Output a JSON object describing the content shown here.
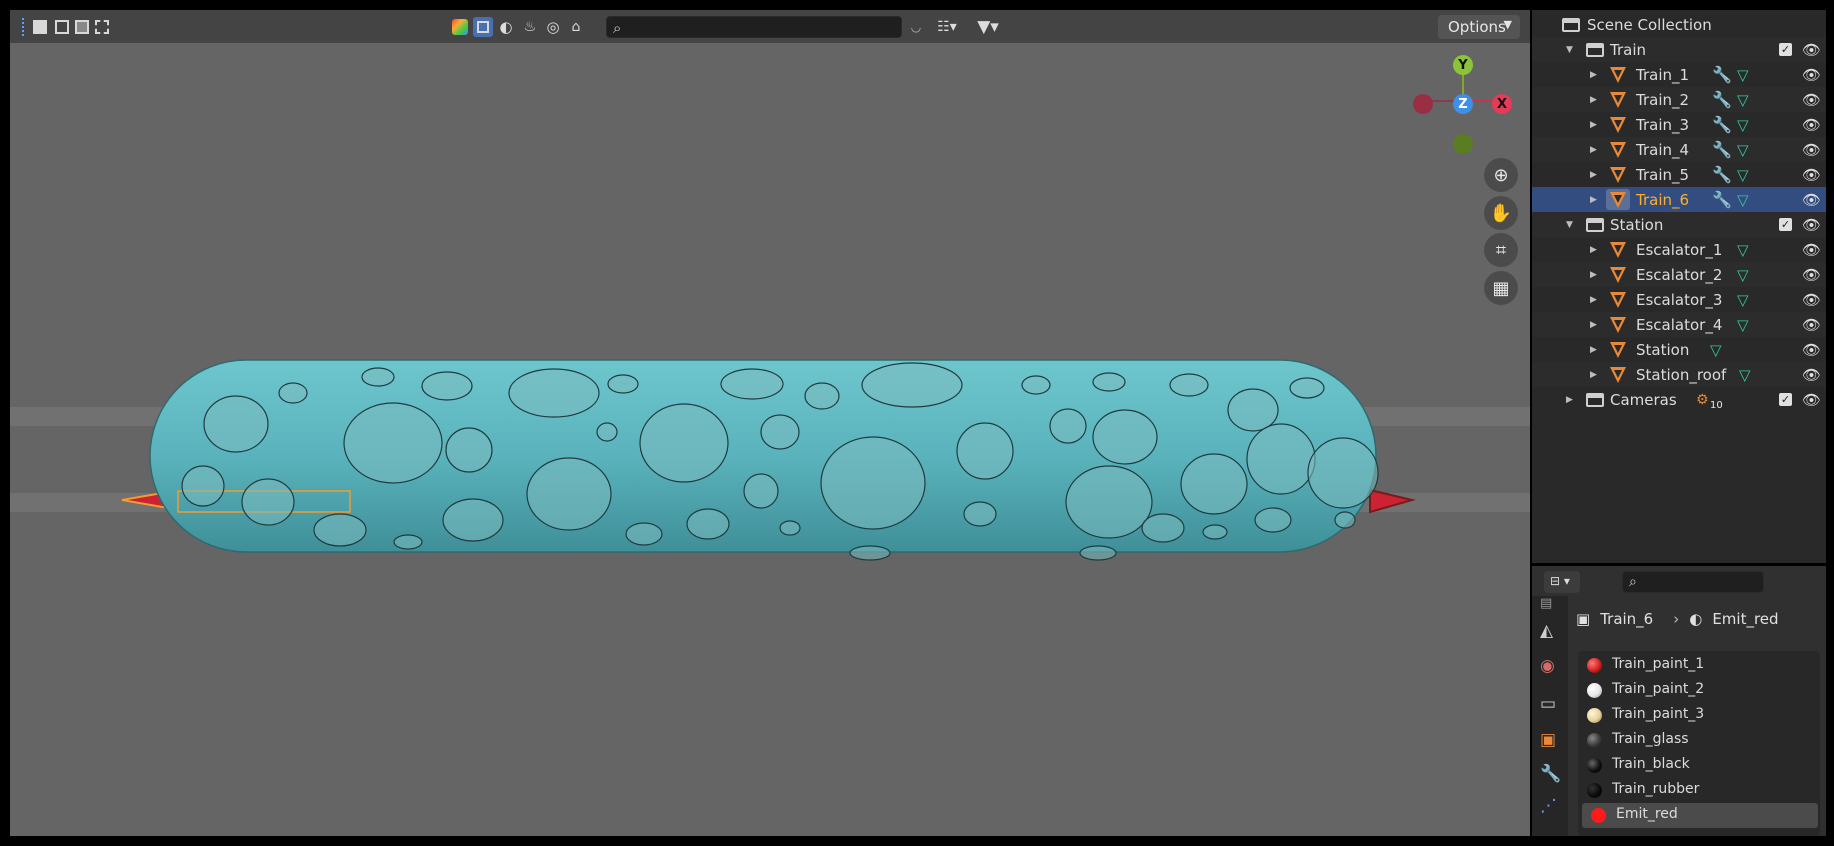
{
  "viewport": {
    "options_label": "Options",
    "search_placeholder": "",
    "gizmo": {
      "y_label": "Y",
      "z_label": "Z",
      "x_label": "X"
    }
  },
  "outliner": {
    "scene_collection": "Scene Collection",
    "rows": [
      {
        "label": "Train",
        "type": "collection"
      },
      {
        "label": "Train_1",
        "type": "mesh"
      },
      {
        "label": "Train_2",
        "type": "mesh"
      },
      {
        "label": "Train_3",
        "type": "mesh"
      },
      {
        "label": "Train_4",
        "type": "mesh"
      },
      {
        "label": "Train_5",
        "type": "mesh"
      },
      {
        "label": "Train_6",
        "type": "mesh",
        "selected": true
      },
      {
        "label": "Station",
        "type": "collection"
      },
      {
        "label": "Escalator_1",
        "type": "mesh"
      },
      {
        "label": "Escalator_2",
        "type": "mesh"
      },
      {
        "label": "Escalator_3",
        "type": "mesh"
      },
      {
        "label": "Escalator_4",
        "type": "mesh"
      },
      {
        "label": "Station",
        "type": "mesh"
      },
      {
        "label": "Station_roof",
        "type": "mesh"
      },
      {
        "label": "Cameras",
        "type": "collection"
      }
    ],
    "cameras_count": "10"
  },
  "properties": {
    "breadcrumb_object": "Train_6",
    "breadcrumb_material": "Emit_red",
    "materials": [
      {
        "label": "Train_paint_1",
        "color": "#d42020"
      },
      {
        "label": "Train_paint_2",
        "color": "#f0f0f0"
      },
      {
        "label": "Train_paint_3",
        "color": "#e6d29a"
      },
      {
        "label": "Train_glass",
        "color": "#3a3a3a"
      },
      {
        "label": "Train_black",
        "color": "#111111"
      },
      {
        "label": "Train_rubber",
        "color": "#0b0b0b"
      },
      {
        "label": "Emit_red",
        "color": "#ff1a1a",
        "active": true
      }
    ]
  },
  "colors": {
    "train_body": "#5bb6bf",
    "selection_orange": "#f39c2f",
    "outliner_selected": "#334d80",
    "mesh_icon": "#e8893a",
    "modifier_icon": "#6f9ce8",
    "data_icon": "#33c7a0"
  }
}
